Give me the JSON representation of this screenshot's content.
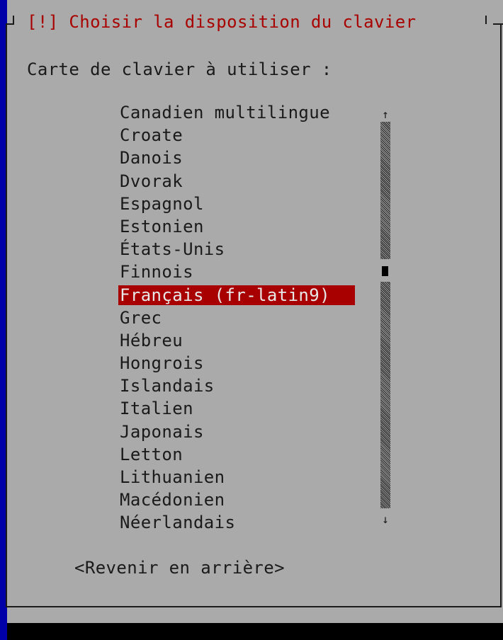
{
  "dialog": {
    "title": "[!] Choisir la disposition du clavier",
    "prompt": "Carte de clavier à utiliser :",
    "back_button_label": "<Revenir en arrière>"
  },
  "keymap_list": {
    "items": [
      "Canadien multilingue",
      "Croate",
      "Danois",
      "Dvorak",
      "Espagnol",
      "Estonien",
      "États-Unis",
      "Finnois",
      "Français (fr-latin9)",
      "Grec",
      "Hébreu",
      "Hongrois",
      "Islandais",
      "Italien",
      "Japonais",
      "Letton",
      "Lithuanien",
      "Macédonien",
      "Néerlandais"
    ],
    "selected": "Français (fr-latin9)"
  },
  "scrollbar": {
    "up_arrow": "↑",
    "down_arrow": "↓"
  },
  "colors": {
    "screen_background": "#0000a8",
    "dialog_background": "#aaaaaa",
    "title_text": "#a80000",
    "selection_background": "#a80000",
    "selection_text": "#e8e8e8",
    "text": "#1a1a1a"
  }
}
